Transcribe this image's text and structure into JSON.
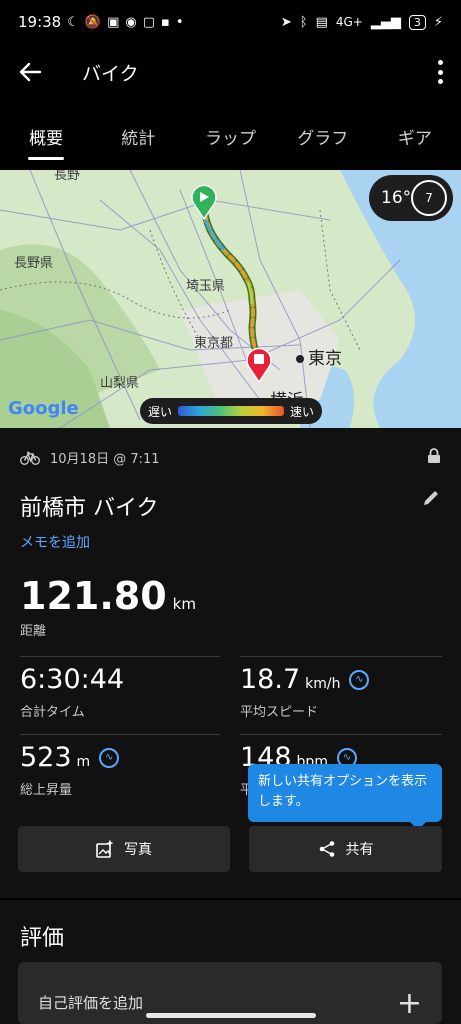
{
  "status_bar": {
    "time": "19:38",
    "network": "4G+",
    "battery": "3"
  },
  "app_bar": {
    "title": "バイク"
  },
  "tabs": [
    {
      "label": "概要",
      "active": true
    },
    {
      "label": "統計",
      "active": false
    },
    {
      "label": "ラップ",
      "active": false
    },
    {
      "label": "グラフ",
      "active": false
    },
    {
      "label": "ギア",
      "active": false
    }
  ],
  "map": {
    "labels": {
      "nagano": "長野県",
      "saitama": "埼玉県",
      "tokyo_to": "東京都",
      "yamanashi": "山梨県",
      "tokyo": "東京",
      "yokohama": "横浜",
      "nagano_top": "長野"
    },
    "temperature": "16°",
    "wind": "7",
    "legend_slow": "遅い",
    "legend_fast": "速い",
    "provider": "Google",
    "route_color_start": "#30b35a",
    "route_color_end": "#e8203a"
  },
  "activity": {
    "date": "10月18日 @ 7:11",
    "title": "前橋市 バイク",
    "memo_link": "メモを追加",
    "distance_value": "121.80",
    "distance_unit": "km",
    "distance_label": "距離",
    "stats": {
      "total_time": {
        "value": "6:30:44",
        "unit": "",
        "label": "合計タイム"
      },
      "avg_speed": {
        "value": "18.7",
        "unit": "km/h",
        "label": "平均スピード"
      },
      "elevation_gain": {
        "value": "523",
        "unit": "m",
        "label": "総上昇量"
      },
      "heart_rate": {
        "value": "148",
        "unit": "bpm",
        "label": "平"
      }
    },
    "tooltip": "新しい共有オプションを表示します。",
    "photo_button": "写真",
    "share_button": "共有"
  },
  "rating": {
    "title": "評価",
    "add_label": "自己評価を追加"
  },
  "colors": {
    "accent_blue": "#1f88e5",
    "link_blue": "#5aa8ff"
  }
}
